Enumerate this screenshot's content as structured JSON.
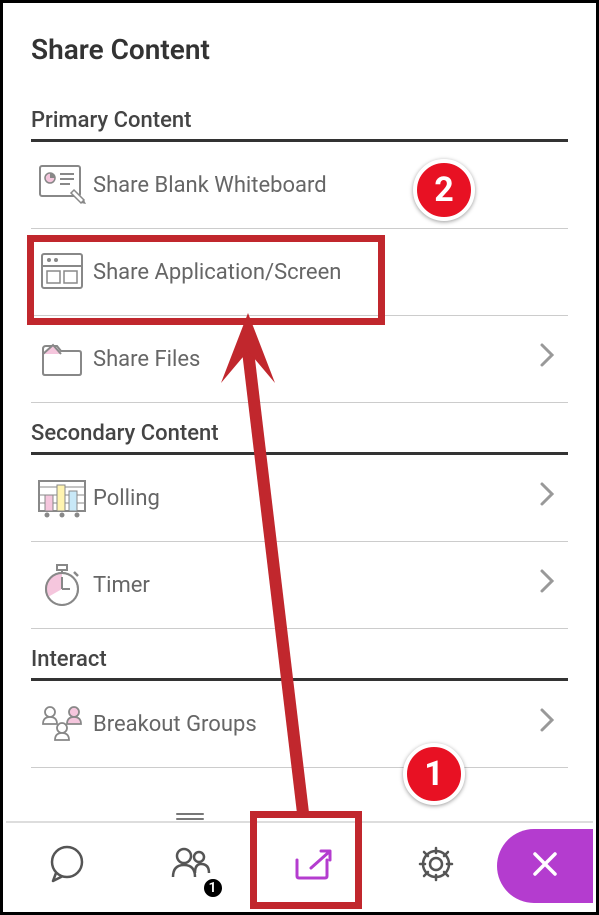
{
  "panel": {
    "title": "Share Content"
  },
  "sections": {
    "primary": {
      "label": "Primary Content",
      "whiteboard": {
        "label": "Share Blank Whiteboard"
      },
      "appscreen": {
        "label": "Share Application/Screen"
      },
      "files": {
        "label": "Share Files"
      }
    },
    "secondary": {
      "label": "Secondary Content",
      "polling": {
        "label": "Polling"
      },
      "timer": {
        "label": "Timer"
      }
    },
    "interact": {
      "label": "Interact",
      "breakout": {
        "label": "Breakout Groups"
      }
    }
  },
  "bottom_nav": {
    "chat_icon": "chat",
    "attendees_icon": "attendees",
    "attendee_count": "1",
    "share_icon": "share",
    "settings_icon": "settings",
    "close_icon": "close"
  },
  "annotations": {
    "step1": "1",
    "step2": "2"
  },
  "colors": {
    "accent_purple": "#b43ccf",
    "annotation_red": "#c1272d",
    "callout_red": "#e81123",
    "pink_fill": "#f5c6dd"
  }
}
